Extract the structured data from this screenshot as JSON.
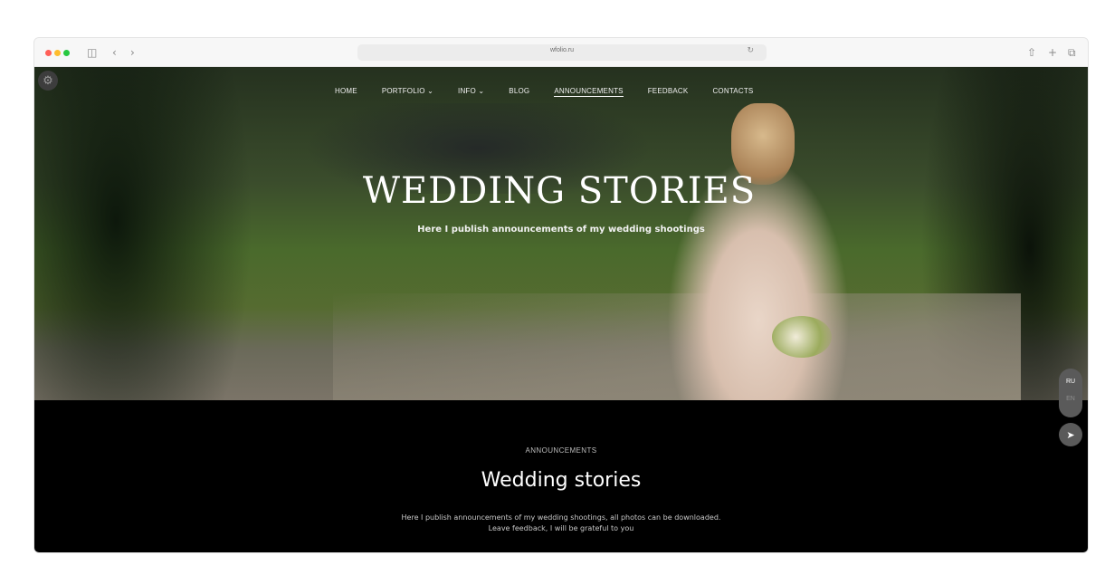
{
  "browser": {
    "url": "wfolio.ru",
    "icons": [
      "close-dot",
      "minimize-dot",
      "maximize-dot",
      "sidebar-icon",
      "back-icon",
      "forward-icon",
      "reload-icon",
      "share-icon",
      "new-tab-icon",
      "tabs-icon"
    ]
  },
  "nav": {
    "items": [
      {
        "label": "HOME"
      },
      {
        "label": "PORTFOLIO ⌄"
      },
      {
        "label": "INFO ⌄"
      },
      {
        "label": "BLOG"
      },
      {
        "label": "ANNOUNCEMENTS",
        "active": true
      },
      {
        "label": "FEEDBACK"
      },
      {
        "label": "CONTACTS"
      }
    ]
  },
  "hero": {
    "title": "WEDDING STORIES",
    "subtitle": "Here I publish announcements of my wedding shootings"
  },
  "section": {
    "eyebrow": "ANNOUNCEMENTS",
    "title": "Wedding stories",
    "description_line1": "Here I publish announcements of my wedding shootings, all photos can be downloaded.",
    "description_line2": "Leave feedback, I will be grateful to you"
  },
  "language": {
    "options": [
      "RU",
      "EN"
    ],
    "selected": "RU"
  },
  "colors": {
    "hero_text": "#ffffff",
    "section_bg": "#000000",
    "widget_bg": "#5a5a5a"
  }
}
